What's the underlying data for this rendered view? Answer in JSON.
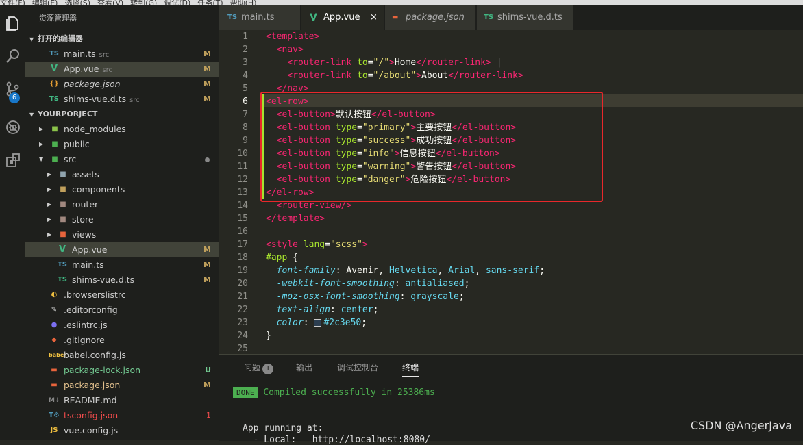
{
  "menubar": {
    "items": [
      "文件(F)",
      "编辑(E)",
      "选择(S)",
      "查看(V)",
      "转到(G)",
      "调试(D)",
      "任务(T)",
      "帮助(H)"
    ]
  },
  "activity": {
    "scm_badge": "6"
  },
  "sidebar": {
    "title": "资源管理器",
    "open_editors_label": "打开的编辑器",
    "open_editors": [
      {
        "icon": "TS",
        "name": "main.ts",
        "sub": "src",
        "status": "M"
      },
      {
        "icon": "V",
        "name": "App.vue",
        "sub": "src",
        "status": "M"
      },
      {
        "icon": "{}",
        "name": "package.json",
        "sub": "",
        "status": "M"
      },
      {
        "icon": "TS",
        "name": "shims-vue.d.ts",
        "sub": "src",
        "status": "M"
      }
    ],
    "project_label": "YOURPORJECT",
    "tree": [
      {
        "name": "node_modules",
        "status": ""
      },
      {
        "name": "public",
        "status": ""
      },
      {
        "name": "src",
        "status": ""
      },
      {
        "name": "assets",
        "status": ""
      },
      {
        "name": "components",
        "status": ""
      },
      {
        "name": "router",
        "status": ""
      },
      {
        "name": "store",
        "status": ""
      },
      {
        "name": "views",
        "status": ""
      },
      {
        "name": "App.vue",
        "status": "M"
      },
      {
        "name": "main.ts",
        "status": "M"
      },
      {
        "name": "shims-vue.d.ts",
        "status": "M"
      },
      {
        "name": ".browserslistrc",
        "status": ""
      },
      {
        "name": ".editorconfig",
        "status": ""
      },
      {
        "name": ".eslintrc.js",
        "status": ""
      },
      {
        "name": ".gitignore",
        "status": ""
      },
      {
        "name": "babel.config.js",
        "status": ""
      },
      {
        "name": "package-lock.json",
        "status": "U"
      },
      {
        "name": "package.json",
        "status": "M"
      },
      {
        "name": "README.md",
        "status": ""
      },
      {
        "name": "tsconfig.json",
        "status": "1"
      },
      {
        "name": "vue.config.js",
        "status": ""
      }
    ]
  },
  "tabs": [
    {
      "icon": "TS",
      "label": "main.ts"
    },
    {
      "icon": "V",
      "label": "App.vue",
      "close": "×"
    },
    {
      "icon": "{}",
      "label": "package.json"
    },
    {
      "icon": "TS",
      "label": "shims-vue.d.ts"
    }
  ],
  "editor": {
    "line_numbers": [
      "1",
      "2",
      "3",
      "4",
      "5",
      "6",
      "7",
      "8",
      "9",
      "10",
      "11",
      "12",
      "13",
      "14",
      "15",
      "16",
      "17",
      "18",
      "19",
      "20",
      "21",
      "22",
      "23",
      "24",
      "25"
    ],
    "active_line": "6"
  },
  "panel": {
    "tabs": [
      "问题",
      "输出",
      "调试控制台",
      "终端"
    ],
    "problems_count": "1",
    "done_badge": "DONE",
    "compiled_text": "Compiled successfully in 25386ms",
    "app_running": "App running at:",
    "local_line": "  - Local:   http://localhost:8080/"
  },
  "watermark": "CSDN @AngerJava"
}
